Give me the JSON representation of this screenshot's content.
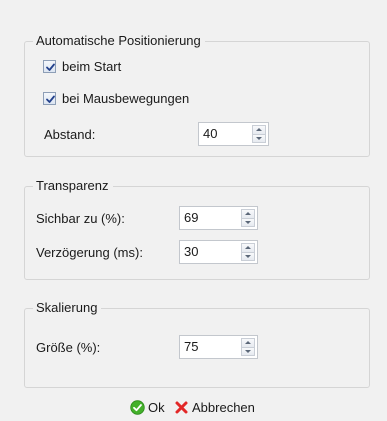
{
  "positioning": {
    "title": "Automatische Positionierung",
    "on_start": {
      "label": "beim Start",
      "checked": true
    },
    "on_mouse_move": {
      "label": "bei Mausbewegungen",
      "checked": true
    },
    "distance": {
      "label": "Abstand:",
      "value": "40"
    }
  },
  "transparency": {
    "title": "Transparenz",
    "visible": {
      "label": "Sichbar zu (%):",
      "value": "69"
    },
    "delay": {
      "label": "Verzögerung (ms):",
      "value": "30"
    }
  },
  "scaling": {
    "title": "Skalierung",
    "size": {
      "label": "Größe (%):",
      "value": "75"
    }
  },
  "footer": {
    "ok_label": "Ok",
    "cancel_label": "Abbrechen"
  },
  "icons": {
    "check": "check-icon",
    "ok": "ok-icon",
    "cancel": "cancel-icon",
    "spin_up": "spin-up-icon",
    "spin_down": "spin-down-icon"
  },
  "colors": {
    "ok_green": "#43b02a",
    "cancel_red": "#e22727",
    "checkmark_blue": "#23418c"
  }
}
